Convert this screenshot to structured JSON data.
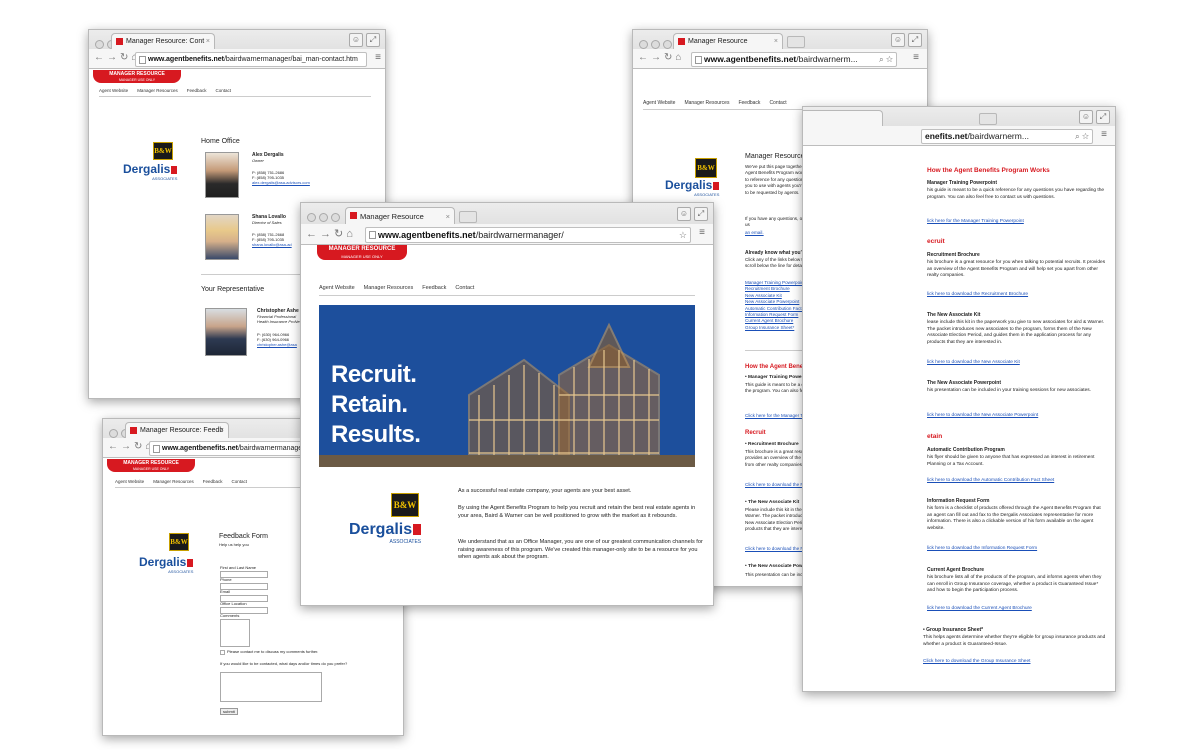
{
  "w1": {
    "tab": "Manager Resource: Cont",
    "url_bold": "www.agentbenefits.net",
    "url_rest": "/bairdwarnermanager/bai_man-contact.htm",
    "ribbon": "MANAGER RESOURCE",
    "ribbon_sub": "MANAGER USE ONLY",
    "nav": [
      "Agent Website",
      "Manager Resources",
      "Feedback",
      "Contact"
    ],
    "logo_bw": "B&W",
    "logo_name": "Dergalis",
    "logo_sub": "ASSOCIATES",
    "home_office": "Home Office",
    "people": [
      {
        "name": "Alex Dergalis",
        "title": "Owner",
        "phone": "P: (858) 751-2686",
        "fax": "F: (858) 795-1035",
        "email": "alex.dergalis@asa-advisors.com"
      },
      {
        "name": "Shana Lovallo",
        "title": "Director of Sales",
        "phone": "P: (858) 751-2668",
        "fax": "F: (858) 795-1035",
        "email": "shana.lovallo@asa-ad"
      }
    ],
    "your_rep": "Your Representative",
    "rep": {
      "name": "Christopher Ashe",
      "title1": "Financial Professional",
      "title2": "Health Insurance ProNet",
      "phone": "P: (630) 964-0966",
      "fax": "F: (630) 964-0966",
      "email": "christopher.ashe@asa"
    }
  },
  "w2": {
    "tab": "Manager Resource",
    "url_bold": "www.agentbenefits.net",
    "url_rest": "/bairdwarnerm...",
    "ribbon": "MANAGER RESOURCE",
    "ribbon_sub": "MANAGER USE ONLY",
    "nav": [
      "Agent Website",
      "Manager Resources",
      "Feedback",
      "Contact"
    ],
    "logo_bw": "B&W",
    "logo_name": "Dergalis",
    "logo_sub": "ASSOCIATES",
    "heading": "Manager Resources",
    "intro": "We've put this page together so that all the materials you'll need to access for the Agent Benefits Program would be in one place. We've also made a training guide to reference for any questions you have about the program, and a brochure for you to use with agents you're trying to recruit. You'll also find the forms most likely to be requested by agents.",
    "questions": "If you have any questions, or would like us to add a document to this page, send us",
    "email_link": "an email.",
    "already_know": "Already know what you're looking for?",
    "already_text": "Click any of the links below to download the file. If you'd like more information, scroll below the line for detailed descriptions.",
    "links": [
      "Manager Training Powerpoint",
      "Recruitment Brochure",
      "New Associate Kit",
      "New Associate Powerpoint",
      "Automatic Contribution Fact Sheet",
      "Information Request Form",
      "Current Agent Brochure",
      "Group Insurance Sheet*"
    ],
    "how_heading": "How the Agent Benefits Program Works",
    "mtp_title": "• Manager Training Powerpoint",
    "mtp_text": "This guide is meant to be a quick reference for any questions you have regarding the program. You can also feel free to contact us with questions.",
    "mtp_link": "Click here for the Manager Training Powerpoint",
    "recruit_heading": "Recruit",
    "rb_title": "• Recruitment Brochure",
    "rb_text": "This brochure is a great resource for you when talking to potential recruits. It provides an overview of the Agent Benefits Program and will help set you apart from other realty companies.",
    "rb_link": "Click here to download the Recruitment Brochure",
    "nak_title": "• The New Associate Kit",
    "nak_text": "Please include this kit in the paperwork you give to new associates for Baird & Warner. The packet introduces new associates to the program, informs them of the New Associate Election Period, and guides them in the application process for any products that they are interested in.",
    "nak_link": "Click here to download the New Associate Kit",
    "nap_title": "• The New Associate Powerpoint",
    "nap_text": "This presentation can be included in your training sessions for new"
  },
  "w3": {
    "url_bold": "enefits.net",
    "url_rest": "/bairdwarnerm...",
    "how_heading": "How the Agent Benefits Program Works",
    "mtp_title": "Manager Training Powerpoint",
    "mtp_text": "his guide is meant to be a quick reference for any questions you have regarding the program. You can also feel free to contact us with questions.",
    "mtp_link": "lick here for the Manager Training Powerpoint",
    "recruit": "ecruit",
    "rb_title": "Recruitment Brochure",
    "rb_text": "his brochure is a great resource for you when talking to potential recruits. It provides an overview of the Agent Benefits Program and will help set you apart from other realty companies.",
    "rb_link": "lick here to download the Recruitment Brochure",
    "nak_title": "The New Associate Kit",
    "nak_text": "lease include this kit in the paperwork you give to new associates for aird & Warner. The packet introduces new associates to the program, forms them of the New Associate Election Period, and guides them in the application process for any products that they are interested in.",
    "nak_link": "lick here to download the New Associate Kit",
    "nap_title": "The New Associate Powerpoint",
    "nap_text": "his presentation can be included in your training sessions for new associates.",
    "nap_link": "lick here to download the New Associate Powerpoint",
    "retain": "etain",
    "acp_title": "Automatic Contribution Program",
    "acp_text": "his flyer should be given to anyone that has expressed an interest in retirement Planning or a Tax Account.",
    "acp_link": "lick here to download the Automatic Contribution Fact Sheet",
    "irf_title": "Information Request Form",
    "irf_text": "his form is a checklist of products offered through the Agent Benefits Program that an agent can fill out and fax to the Dergalis Associates representative for more information. There is also a clickable version of his form available on the agent website.",
    "irf_link": "lick here to download the Information Request Form",
    "cab_title": "Current Agent Brochure",
    "cab_text": "his brochure lists all of the products of the program, and informs agents when they can enroll in Group Insurance coverage, whether a product is Guaranteed Issue* and how to begin the participation process.",
    "cab_link": "lick here to download the Current Agent Brochure",
    "gis_title": "• Group Insurance Sheet*",
    "gis_text": "This helps agents determine whether they're eligible for group insurance products and whether a product is Guaranteed-Issue.",
    "gis_link": "Click here to download the Group Insurance Sheet"
  },
  "w4": {
    "tab": "Manager Resource: Feedb",
    "url_bold": "www.agentbenefits.net",
    "url_rest": "/bairdwarnermanager/bai_m",
    "ribbon": "MANAGER RESOURCE",
    "ribbon_sub": "MANAGER USE ONLY",
    "nav": [
      "Agent Website",
      "Manager Resources",
      "Feedback",
      "Contact"
    ],
    "logo_bw": "B&W",
    "logo_name": "Dergalis",
    "logo_sub": "ASSOCIATES",
    "form_title": "Feedback Form",
    "form_sub": "Help us help you",
    "fields": [
      "First and Last Name",
      "Phone",
      "Email",
      "Office Location",
      "Comments"
    ],
    "checkbox": "Please contact me to discuss my comments further.",
    "prefer": "If you would like to be contacted, what days and/or times do you prefer?",
    "submit": "submit"
  },
  "w5": {
    "tab": "Manager Resource",
    "url_bold": "www.agentbenefits.net",
    "url_rest": "/bairdwarnermanager/",
    "ribbon": "MANAGER RESOURCE",
    "ribbon_sub": "MANAGER USE ONLY",
    "nav": [
      "Agent Website",
      "Manager Resources",
      "Feedback",
      "Contact"
    ],
    "hero": [
      "Recruit.",
      "Retain.",
      "Results."
    ],
    "logo_bw": "B&W",
    "logo_name": "Dergalis",
    "logo_sub": "ASSOCIATES",
    "p1": "As a successful real estate company, your agents are your best asset.",
    "p2": "By using the Agent Benefits Program to help you recruit and retain the best real estate agents in your area, Baird & Warner can be well positioned to grow with the market as it rebounds.",
    "p3": "We understand that as an Office Manager, you are one of our greatest communication channels for raising awareness of this program. We've created this manager-only site to be a resource for you when agents ask about the program."
  },
  "colors": {
    "brand_red": "#d71920",
    "link_blue": "#1a4fb8",
    "hero_blue": "#1d4f9c"
  }
}
